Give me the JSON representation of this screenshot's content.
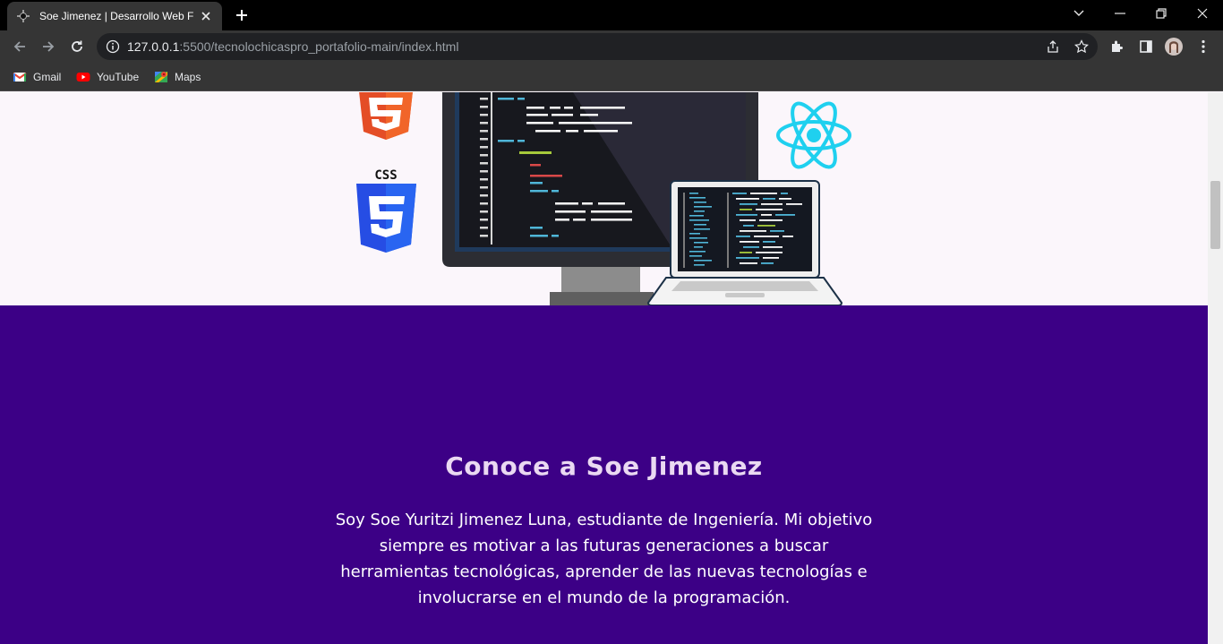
{
  "browser": {
    "tab": {
      "title": "Soe Jimenez | Desarrollo Web Fro",
      "close_icon": "close-icon"
    },
    "new_tab_icon": "plus-icon",
    "url": {
      "host": "127.0.0.1",
      "path": ":5500/tecnolochicaspro_portafolio-main/index.html"
    },
    "bookmarks": [
      {
        "label": "Gmail",
        "icon": "gmail-icon"
      },
      {
        "label": "YouTube",
        "icon": "youtube-icon"
      },
      {
        "label": "Maps",
        "icon": "maps-icon"
      }
    ]
  },
  "hero": {
    "css_badge": "CSS"
  },
  "about": {
    "title": "Conoce a Soe Jimenez",
    "body": "Soy Soe Yuritzi Jimenez Luna, estudiante de Ingeniería. Mi objetivo siempre es motivar a las futuras generaciones a buscar herramientas tecnológicas, aprender de las nuevas tecnologías e involucrarse en el mundo de la programación."
  },
  "colors": {
    "about_bg": "#3c0086",
    "page_bg": "#fbf6fb",
    "html5_orange": "#e44d26",
    "css3_blue": "#264de4",
    "react_cyan": "#1fd0ef"
  }
}
